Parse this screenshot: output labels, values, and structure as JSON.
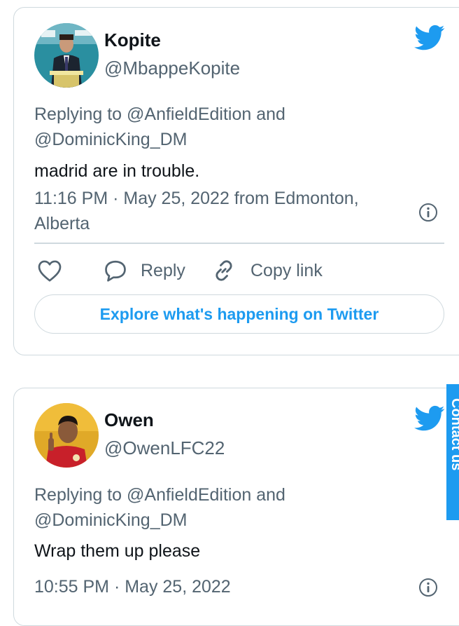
{
  "tweets": [
    {
      "name": "Kopite",
      "handle": "@MbappeKopite",
      "reply_prefix": "Replying to",
      "reply_mention_1": "@AnfieldEdition",
      "reply_and": "and",
      "reply_mention_2": "@DominicKing_DM",
      "text": "madrid are in trouble.",
      "meta_line_1": "11:16 PM · May 25, 2022 from Edmonton,",
      "meta_line_2": "Alberta",
      "actions": {
        "reply": "Reply",
        "copy_link": "Copy link"
      },
      "explore_button": "Explore what's happening on Twitter"
    },
    {
      "name": "Owen",
      "handle": "@OwenLFC22",
      "reply_prefix": "Replying to",
      "reply_mention_1": "@AnfieldEdition",
      "reply_and": "and",
      "reply_mention_2": "@DominicKing_DM",
      "text": "Wrap them up please",
      "meta_line_1": "10:55 PM · May 25, 2022"
    }
  ],
  "side_tab": {
    "label": "Contact us"
  },
  "colors": {
    "twitter_blue": "#1d9bf0",
    "secondary_text": "#536471",
    "border": "#cfd9de"
  },
  "icons": [
    "twitter-bird-icon",
    "info-icon",
    "heart-icon",
    "reply-bubble-icon",
    "link-icon"
  ]
}
